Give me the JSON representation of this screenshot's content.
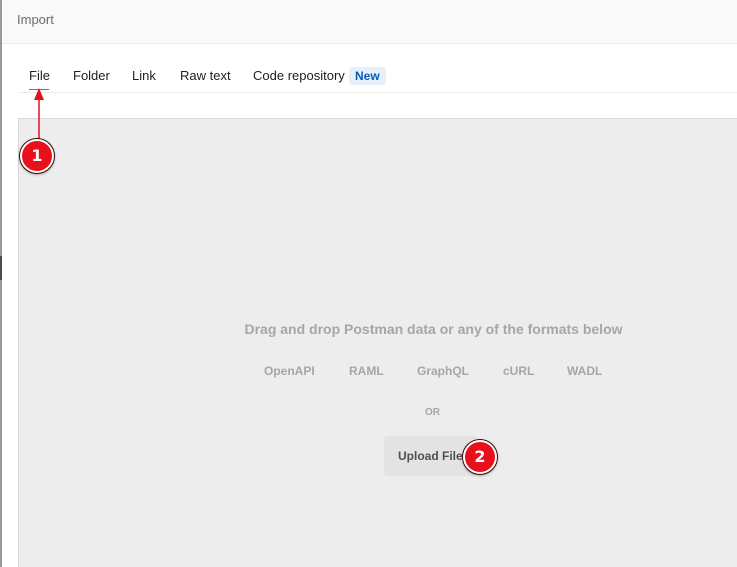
{
  "header": {
    "title": "Import"
  },
  "tabs": [
    {
      "label": "File",
      "active": true
    },
    {
      "label": "Folder"
    },
    {
      "label": "Link"
    },
    {
      "label": "Raw text"
    },
    {
      "label": "Code repository",
      "badge": "New"
    }
  ],
  "dropzone": {
    "title": "Drag and drop Postman data or any of the formats below",
    "formats": [
      "OpenAPI",
      "RAML",
      "GraphQL",
      "cURL",
      "WADL"
    ],
    "or_text": "OR",
    "upload_label": "Upload Files"
  },
  "callouts": [
    "1",
    "2"
  ],
  "colors": {
    "accent": "#e8452c",
    "badge_bg": "#e6f0fc",
    "badge_text": "#0a5bb5",
    "callout": "#e8111b",
    "dropzone_bg": "#ededed"
  }
}
